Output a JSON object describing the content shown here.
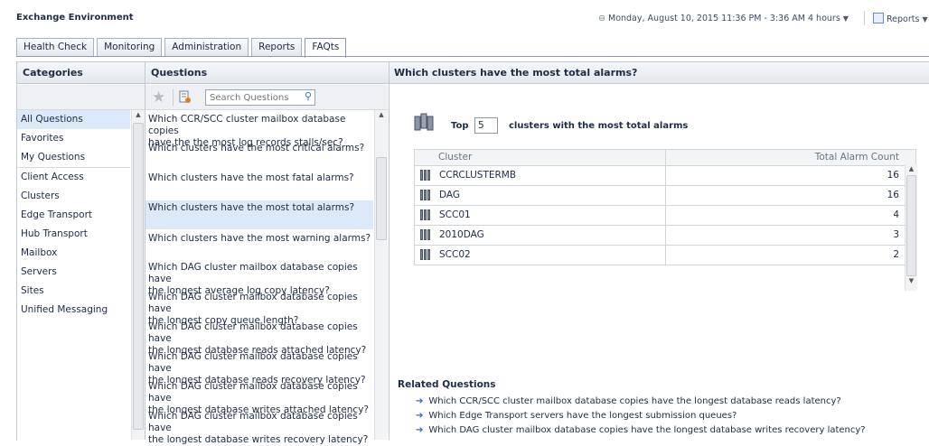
{
  "app": {
    "title": "Exchange Environment",
    "timerange": "Monday, August 10, 2015 11:36 PM - 3:36 AM 4 hours",
    "reports_label": "Reports"
  },
  "tabs": [
    {
      "label": "Health Check"
    },
    {
      "label": "Monitoring"
    },
    {
      "label": "Administration"
    },
    {
      "label": "Reports"
    },
    {
      "label": "FAQts",
      "active": true
    }
  ],
  "categories": {
    "header": "Categories",
    "items": [
      {
        "label": "All Questions",
        "selected": true
      },
      {
        "label": "Favorites"
      },
      {
        "label": "My Questions"
      },
      {
        "label": "Client Access"
      },
      {
        "label": "Clusters"
      },
      {
        "label": "Edge Transport"
      },
      {
        "label": "Hub Transport"
      },
      {
        "label": "Mailbox"
      },
      {
        "label": "Servers"
      },
      {
        "label": "Sites"
      },
      {
        "label": "Unified Messaging"
      }
    ]
  },
  "questions": {
    "header": "Questions",
    "search_placeholder": "Search Questions",
    "items": [
      {
        "l1": "Which CCR/SCC cluster mailbox database copies",
        "l2": "have the the most log records stalls/sec?"
      },
      {
        "l1": "Which clusters have the most critical alarms?",
        "l2": ""
      },
      {
        "l1": "Which clusters have the most fatal alarms?",
        "l2": ""
      },
      {
        "l1": "Which clusters have the most total alarms?",
        "l2": "",
        "selected": true
      },
      {
        "l1": "Which clusters have the most warning alarms?",
        "l2": ""
      },
      {
        "l1": "Which DAG cluster mailbox database copies have",
        "l2": "the longest average log copy latency?"
      },
      {
        "l1": "Which DAG cluster mailbox database copies have",
        "l2": "the longest copy queue length?"
      },
      {
        "l1": "Which DAG cluster mailbox database copies have",
        "l2": "the longest database reads attached latency?"
      },
      {
        "l1": "Which DAG cluster mailbox database copies have",
        "l2": "the longest database reads recovery latency?"
      },
      {
        "l1": "Which DAG cluster mailbox database copies have",
        "l2": "the longest database writes attached latency?"
      },
      {
        "l1": "Which DAG cluster mailbox database copies have",
        "l2": "the longest database writes recovery latency?"
      }
    ]
  },
  "result": {
    "title": "Which clusters have the most total alarms?",
    "top_label": "Top",
    "top_value": "5",
    "top_suffix": "clusters with the most total alarms",
    "columns": {
      "cluster": "Cluster",
      "count": "Total Alarm Count"
    },
    "rows": [
      {
        "cluster": "CCRCLUSTERMB",
        "count": "16"
      },
      {
        "cluster": "DAG",
        "count": "16"
      },
      {
        "cluster": "SCC01",
        "count": "4"
      },
      {
        "cluster": "2010DAG",
        "count": "3"
      },
      {
        "cluster": "SCC02",
        "count": "2"
      }
    ]
  },
  "related": {
    "title": "Related Questions",
    "items": [
      "Which CCR/SCC cluster mailbox database copies have the longest database reads latency?",
      "Which Edge Transport servers have the longest submission queues?",
      "Which DAG cluster mailbox database copies have the longest database writes recovery latency?"
    ]
  }
}
